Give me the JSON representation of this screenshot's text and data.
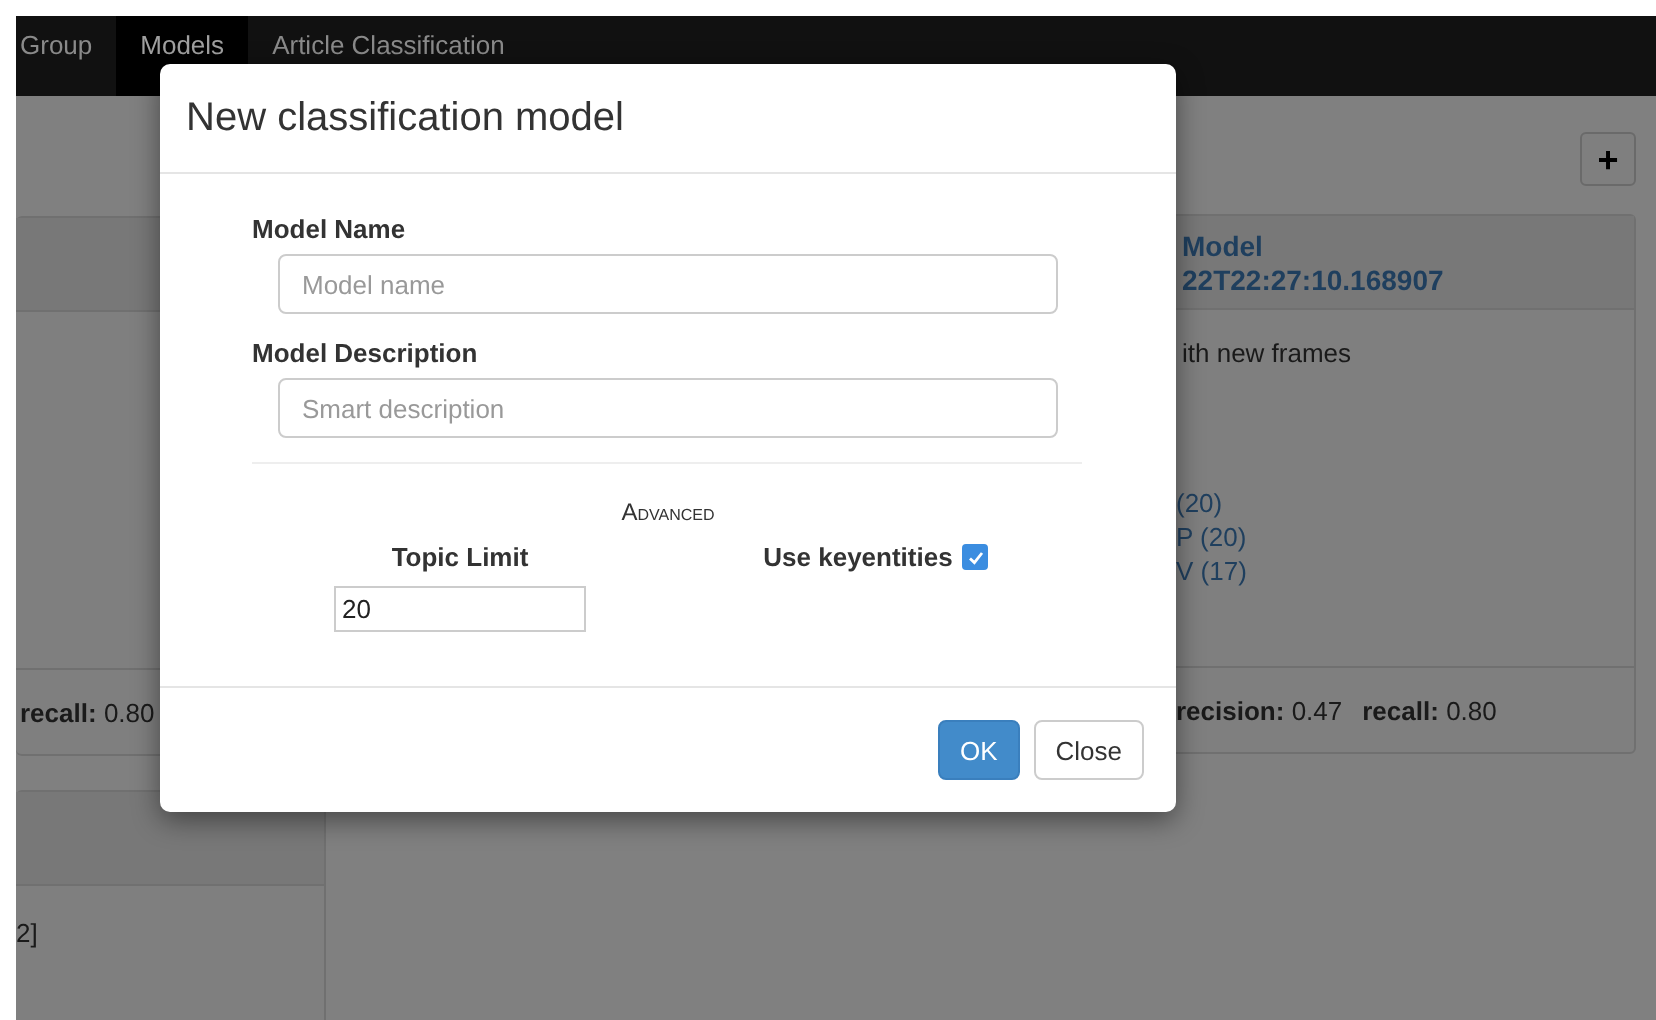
{
  "navbar": {
    "tabs": [
      {
        "label": "Group",
        "selected": false
      },
      {
        "label": "Models",
        "selected": true
      },
      {
        "label": "Article Classification",
        "selected": false
      }
    ]
  },
  "background": {
    "add_button": "+",
    "left_card": {
      "footer": [
        {
          "label": "recall:",
          "value": "0.80"
        }
      ]
    },
    "lower_card": {
      "body": "2]"
    },
    "right_card": {
      "title": "Model",
      "subtitle": "22T22:27:10.168907",
      "description": "ith new frames",
      "links": [
        "(20)",
        "P (20)",
        "V (17)"
      ],
      "footer": [
        {
          "label": "recision:",
          "value": "0.47"
        },
        {
          "label": "recall:",
          "value": "0.80"
        }
      ]
    }
  },
  "modal": {
    "title": "New classification model",
    "fields": [
      {
        "label": "Model Name",
        "placeholder": "Model name"
      },
      {
        "label": "Model Description",
        "placeholder": "Smart description"
      }
    ],
    "section": "Advanced",
    "topic_limit": {
      "label": "Topic Limit",
      "value": "20"
    },
    "use_keyentities": {
      "label": "Use keyentities",
      "checked": true
    },
    "buttons": [
      {
        "label": "OK",
        "kind": "primary"
      },
      {
        "label": "Close",
        "kind": "default"
      }
    ]
  }
}
